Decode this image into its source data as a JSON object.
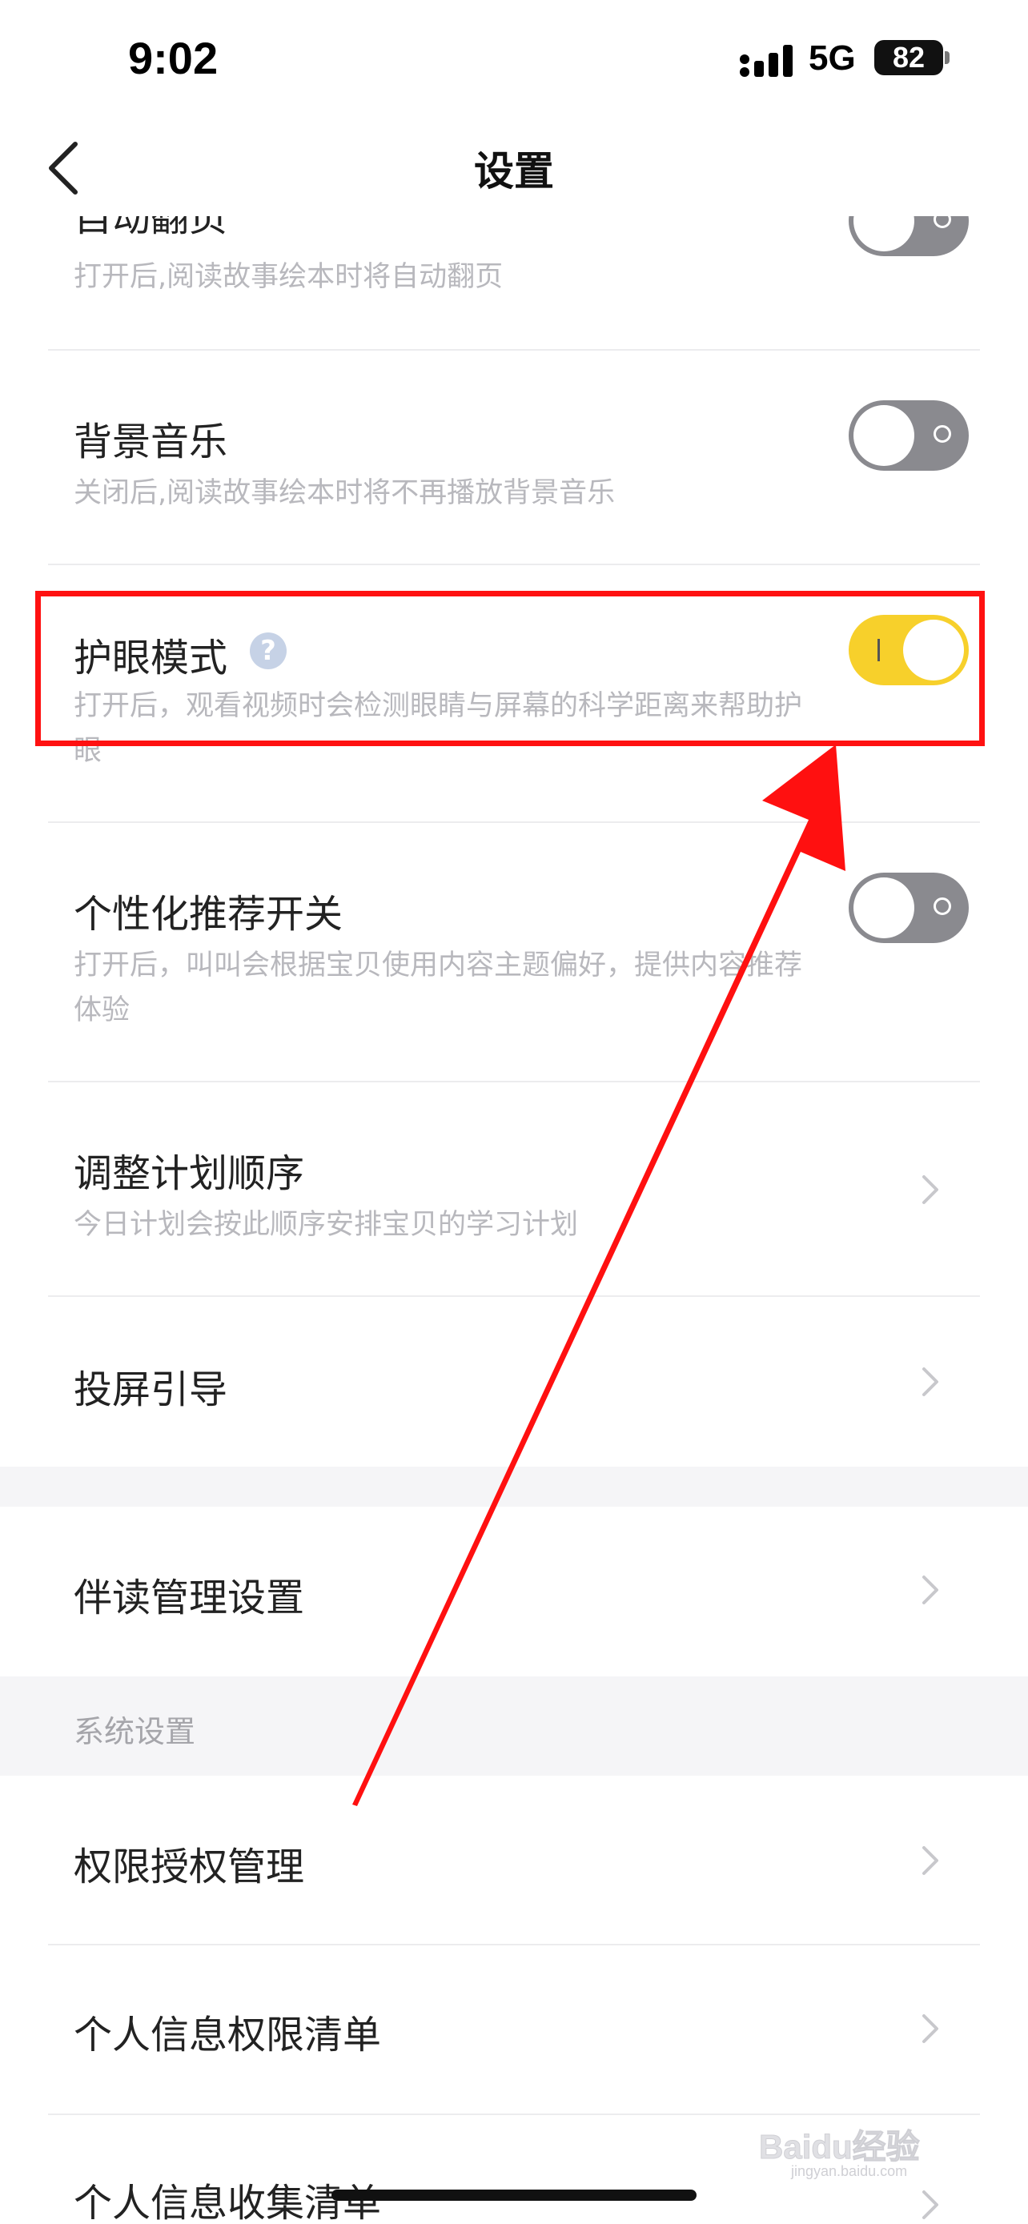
{
  "status_bar": {
    "time": "9:02",
    "network": "5G",
    "battery": "82"
  },
  "nav": {
    "title": "设置",
    "back_icon": "chevron-left-icon"
  },
  "settings": {
    "auto_page": {
      "title": "自动翻页",
      "desc": "打开后,阅读故事绘本时将自动翻页",
      "enabled": false
    },
    "bg_music": {
      "title": "背景音乐",
      "desc": "关闭后,阅读故事绘本时将不再播放背景音乐",
      "enabled": false
    },
    "eye_care": {
      "title": "护眼模式",
      "help_icon": "?",
      "desc": "打开后，观看视频时会检测眼睛与屏幕的科学距离来帮助护眼",
      "enabled": true
    },
    "personalized": {
      "title": "个性化推荐开关",
      "desc": "打开后，叫叫会根据宝贝使用内容主题偏好，提供内容推荐体验",
      "enabled": false
    },
    "plan_order": {
      "title": "调整计划顺序",
      "desc": "今日计划会按此顺序安排宝贝的学习计划"
    },
    "cast_guide": {
      "title": "投屏引导"
    },
    "companion": {
      "title": "伴读管理设置"
    },
    "system_section": {
      "label": "系统设置"
    },
    "permissions": {
      "title": "权限授权管理"
    },
    "personal_info_permissions": {
      "title": "个人信息权限清单"
    },
    "personal_info_collection": {
      "title": "个人信息收集清单"
    }
  },
  "colors": {
    "toggle_on": "#f7d02b",
    "toggle_off": "#8a8a8f",
    "highlight": "#ff1111"
  },
  "watermark": {
    "logo": "Baidu经验",
    "url": "jingyan.baidu.com"
  }
}
